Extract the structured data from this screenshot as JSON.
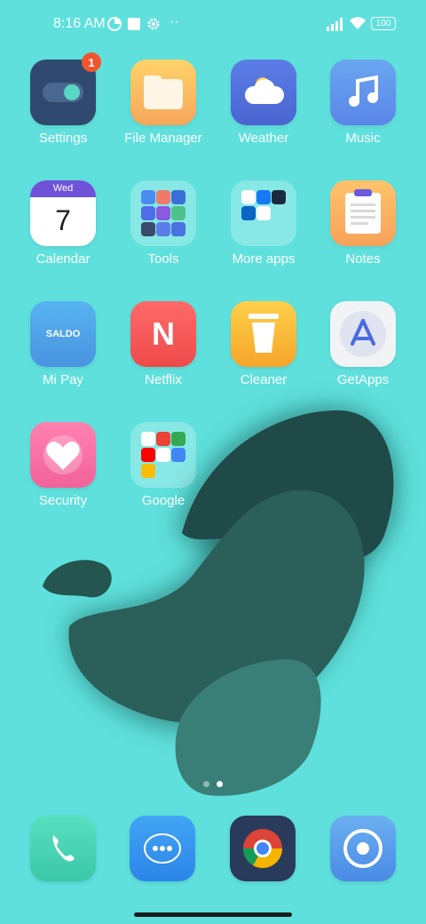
{
  "status_bar": {
    "time": "8:16 AM",
    "battery": "100",
    "more_indicator": "··"
  },
  "apps": {
    "settings": {
      "label": "Settings",
      "badge": "1"
    },
    "file_manager": {
      "label": "File Manager"
    },
    "weather": {
      "label": "Weather"
    },
    "music": {
      "label": "Music"
    },
    "calendar": {
      "label": "Calendar",
      "day": "Wed",
      "date": "7"
    },
    "tools": {
      "label": "Tools"
    },
    "more_apps": {
      "label": "More apps"
    },
    "notes": {
      "label": "Notes"
    },
    "mi_pay": {
      "label": "Mi Pay",
      "icon_text": "SALDO"
    },
    "netflix": {
      "label": "Netflix",
      "icon_text": "N"
    },
    "cleaner": {
      "label": "Cleaner"
    },
    "getapps": {
      "label": "GetApps"
    },
    "security": {
      "label": "Security"
    },
    "google": {
      "label": "Google"
    }
  },
  "dock": {
    "phone": "phone-icon",
    "messages": "messages-icon",
    "chrome": "chrome-icon",
    "camera": "camera-icon"
  },
  "page_indicator": {
    "pages": 2,
    "current": 2
  },
  "colors": {
    "wallpaper": "#5fe0dc",
    "blob_dark": "#1f4a47",
    "blob_mid": "#2f6c66",
    "badge": "#f2552c"
  }
}
